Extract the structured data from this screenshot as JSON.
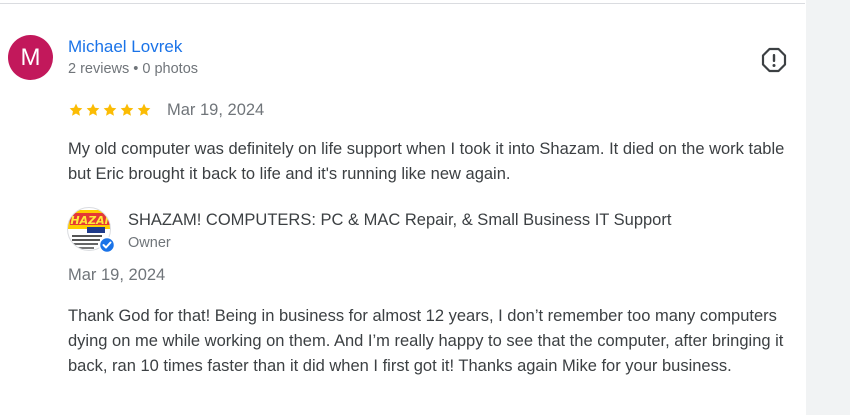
{
  "review": {
    "avatar_initial": "M",
    "avatar_color": "#c2185b",
    "reviewer_name": "Michael Lovrek",
    "reviewer_meta": "2 reviews • 0 photos",
    "rating": 5,
    "rating_max": 5,
    "date": "Mar 19, 2024",
    "text": "My old computer was definitely on life support when I took it into Shazam. It died on the work table but Eric brought it back to life and it's running like new again.",
    "flag_icon": "report-flag-icon"
  },
  "owner_response": {
    "logo_text": "SHAZAM",
    "business_name": "SHAZAM! COMPUTERS: PC & MAC Repair, & Small Business IT Support",
    "role": "Owner",
    "date": "Mar 19, 2024",
    "text": "Thank God for that! Being in business for almost 12 years, I don’t remember too many computers dying on me while working on them. And I’m really happy to see that the computer, after bringing it back, ran 10 times faster than it did when I first got it! Thanks again Mike for your business."
  },
  "colors": {
    "link_blue": "#1a73e8",
    "star_gold": "#fbbc04",
    "muted_text": "#70757a",
    "verified_blue": "#1a73e8"
  }
}
